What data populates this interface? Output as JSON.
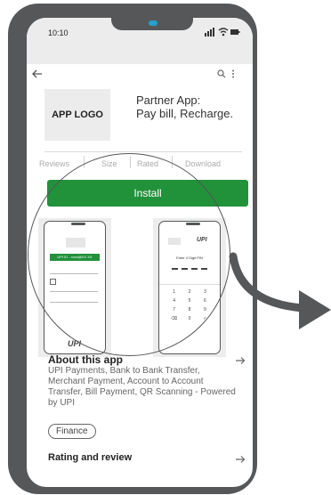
{
  "status": {
    "time": "10:10"
  },
  "toolbar": {
    "back_icon": "back-arrow-icon",
    "search_icon": "search-icon",
    "more_icon": "more-icon"
  },
  "app": {
    "logo_text": "APP LOGO",
    "title_line1": "Partner App:",
    "title_line2": "Pay bill, Recharge."
  },
  "tabs": [
    "Reviews",
    "Size",
    "Rated",
    "Download"
  ],
  "install_label": "Install",
  "screenshot1": {
    "banner": "UPI ID - xxxx@XX XX",
    "upi": "UPI"
  },
  "screenshot2": {
    "heading": "Enter 4 Digit PIN",
    "keys": [
      "1",
      "2",
      "3",
      "4",
      "5",
      "6",
      "7",
      "8",
      "9",
      "⌫",
      "0",
      "✓"
    ],
    "upi": "UPI"
  },
  "about": {
    "title": "About this app",
    "description": "UPI Payments, Bank to Bank Transfer, Merchant Payment, Account to Account Transfer, Bill Payment, QR Scanning - Powered by UPI",
    "category": "Finance"
  },
  "rating": {
    "title": "Rating and review"
  },
  "colors": {
    "install": "#21913a",
    "frame": "#555759",
    "camera": "#25a0d0"
  }
}
